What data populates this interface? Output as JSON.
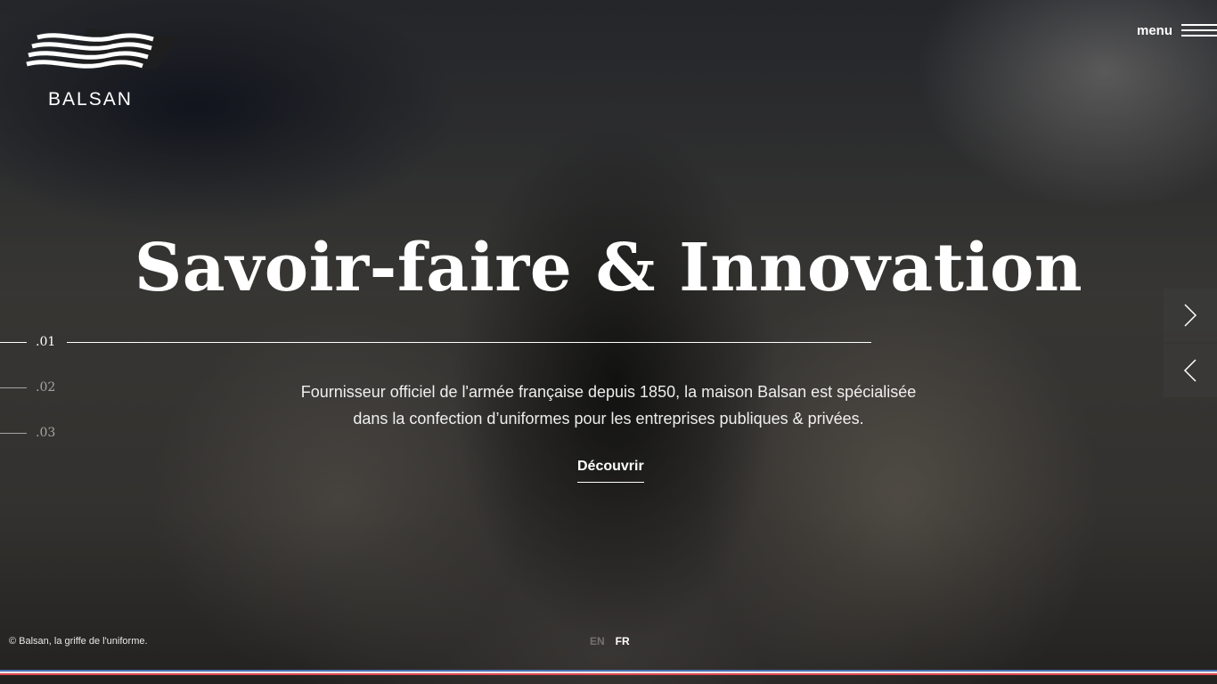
{
  "brand": {
    "name": "BALSAN"
  },
  "header": {
    "menu_label": "menu",
    "menu_icon": "hamburger-icon"
  },
  "hero": {
    "title": "Savoir-faire & Innovation",
    "description_lines": [
      "Fournisseur officiel de l'armée française depuis 1850, la maison Balsan est spécialisée",
      "dans la confection d’uniformes pour les entreprises publiques & privées."
    ],
    "cta_label": "Découvrir"
  },
  "slides": {
    "items": [
      {
        "label": ".01",
        "active": true
      },
      {
        "label": ".02",
        "active": false
      },
      {
        "label": ".03",
        "active": false
      }
    ],
    "next_icon": "chevron-right-icon",
    "prev_icon": "chevron-left-icon"
  },
  "footer": {
    "copyright": "© Balsan, la griffe de l'uniforme.",
    "languages": [
      {
        "code": "EN",
        "active": false
      },
      {
        "code": "FR",
        "active": true
      }
    ]
  },
  "colors": {
    "flag_blue": "#4a6fb5",
    "flag_white": "#eaeaea",
    "flag_red": "#e0484e"
  }
}
